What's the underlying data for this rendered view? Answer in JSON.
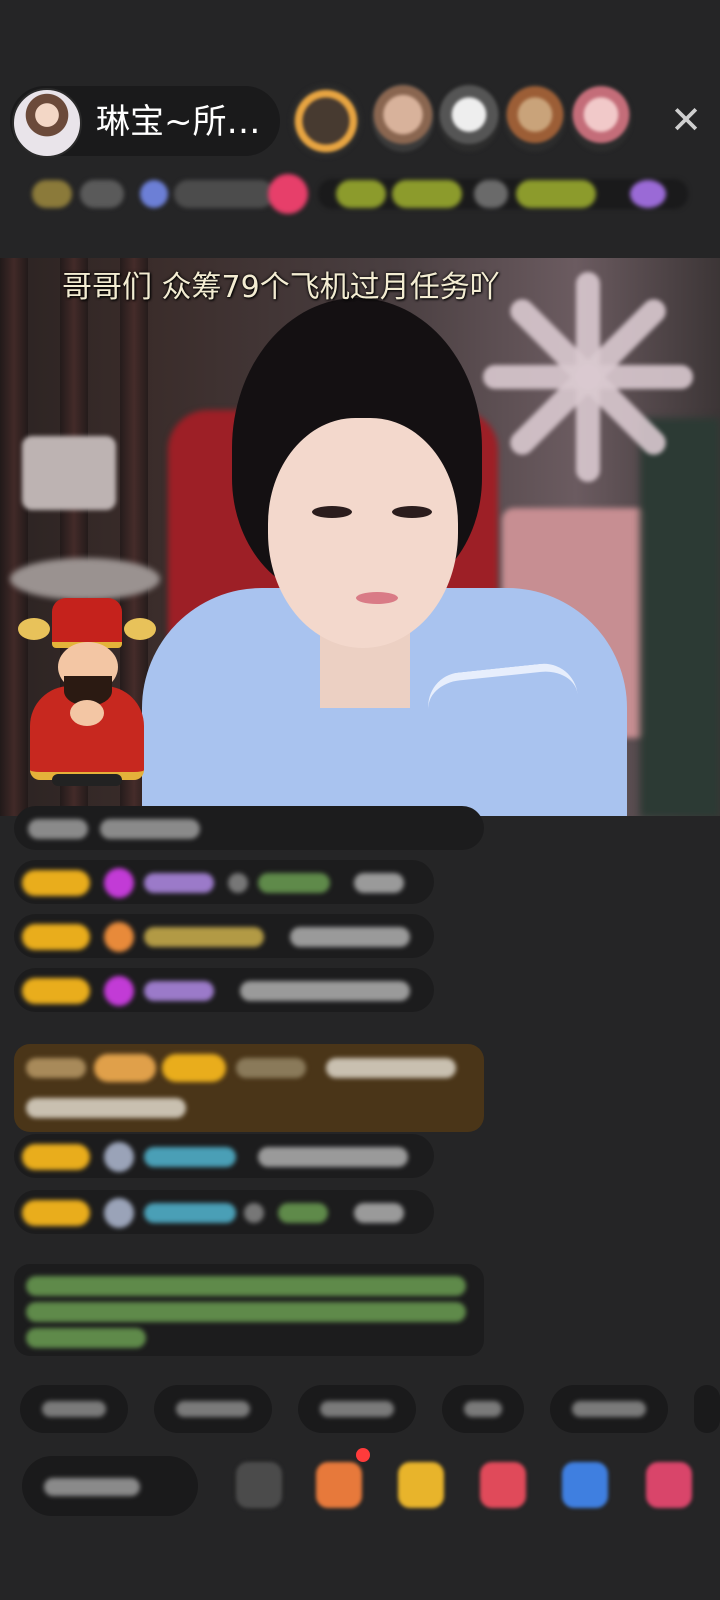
{
  "header": {
    "host_name": "琳宝~所…",
    "close_icon": "✕"
  },
  "video": {
    "banner_text": "哥哥们 众筹79个飞机过月任务吖"
  },
  "colors": {
    "background": "#252526",
    "badge": "#e9ad1c",
    "gift_bubble": "#4a3518",
    "notification_dot": "#ff3b3b"
  },
  "icons": [
    "close-icon",
    "gift-icon",
    "red-packet-icon",
    "wish-icon",
    "game-icon",
    "more-icon"
  ]
}
